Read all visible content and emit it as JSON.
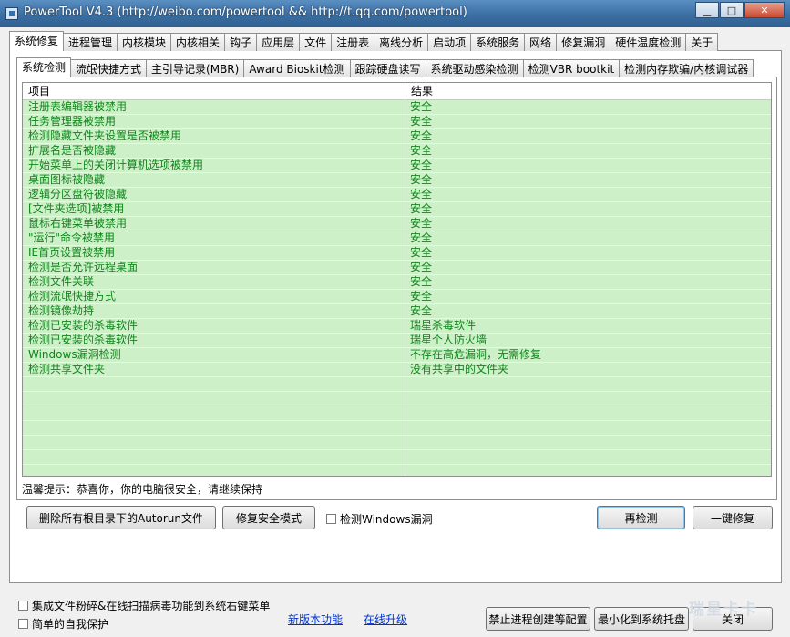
{
  "window": {
    "title": "PowerTool V4.3 (http://weibo.com/powertool && http://t.qq.com/powertool)"
  },
  "main_tabs": [
    {
      "label": "系统修复",
      "active": true
    },
    {
      "label": "进程管理"
    },
    {
      "label": "内核模块"
    },
    {
      "label": "内核相关"
    },
    {
      "label": "钩子"
    },
    {
      "label": "应用层"
    },
    {
      "label": "文件"
    },
    {
      "label": "注册表"
    },
    {
      "label": "离线分析"
    },
    {
      "label": "启动项"
    },
    {
      "label": "系统服务"
    },
    {
      "label": "网络"
    },
    {
      "label": "修复漏洞"
    },
    {
      "label": "硬件温度检测"
    },
    {
      "label": "关于"
    }
  ],
  "sub_tabs": [
    {
      "label": "系统检测",
      "active": true
    },
    {
      "label": "流氓快捷方式"
    },
    {
      "label": "主引导记录(MBR)"
    },
    {
      "label": "Award Bioskit检测"
    },
    {
      "label": "跟踪硬盘读写"
    },
    {
      "label": "系统驱动感染检测"
    },
    {
      "label": "检测VBR bootkit"
    },
    {
      "label": "检测内存欺骗/内核调试器"
    }
  ],
  "table": {
    "columns": [
      "项目",
      "结果"
    ],
    "rows": [
      [
        "注册表编辑器被禁用",
        "安全"
      ],
      [
        "任务管理器被禁用",
        "安全"
      ],
      [
        "检测隐藏文件夹设置是否被禁用",
        "安全"
      ],
      [
        "扩展名是否被隐藏",
        "安全"
      ],
      [
        "开始菜单上的关闭计算机选项被禁用",
        "安全"
      ],
      [
        "桌面图标被隐藏",
        "安全"
      ],
      [
        "逻辑分区盘符被隐藏",
        "安全"
      ],
      [
        "[文件夹选项]被禁用",
        "安全"
      ],
      [
        "鼠标右键菜单被禁用",
        "安全"
      ],
      [
        "\"运行\"命令被禁用",
        "安全"
      ],
      [
        "IE首页设置被禁用",
        "安全"
      ],
      [
        "检测是否允许远程桌面",
        "安全"
      ],
      [
        "检测文件关联",
        "安全"
      ],
      [
        "检测流氓快捷方式",
        "安全"
      ],
      [
        "检测镜像劫持",
        "安全"
      ],
      [
        "检测已安装的杀毒软件",
        "瑞星杀毒软件"
      ],
      [
        "检测已安装的杀毒软件",
        "瑞星个人防火墙"
      ],
      [
        "Windows漏洞检测",
        "不存在高危漏洞，无需修复"
      ],
      [
        "检测共享文件夹",
        "没有共享中的文件夹"
      ]
    ]
  },
  "tip": "温馨提示：恭喜你，你的电脑很安全，请继续保持",
  "buttons": {
    "delete_autorun": "删除所有根目录下的Autorun文件",
    "repair_safe_mode": "修复安全模式",
    "recheck": "再检测",
    "one_click_repair": "一键修复",
    "block_process": "禁止进程创建等配置",
    "minimize_tray": "最小化到系统托盘",
    "close": "关闭"
  },
  "checkboxes": {
    "check_windows_vuln": "检测Windows漏洞",
    "integrate_shredder": "集成文件粉碎&在线扫描病毒功能到系统右键菜单",
    "self_protect": "简单的自我保护"
  },
  "links": {
    "new_features": "新版本功能",
    "online_update": "在线升级"
  },
  "watermark": "瑞星卡卡"
}
